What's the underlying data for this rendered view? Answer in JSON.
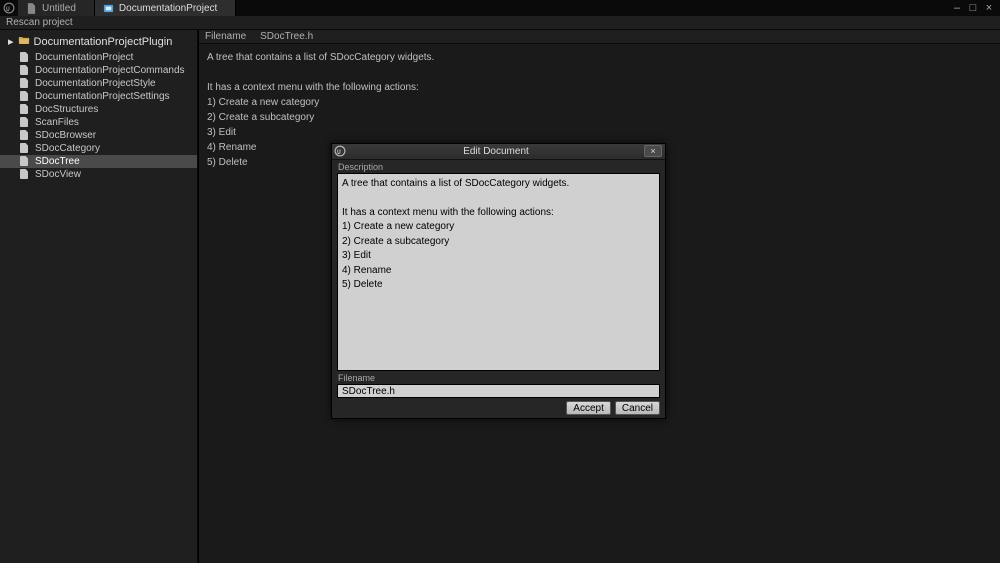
{
  "tabs": [
    {
      "label": "Untitled",
      "active": false
    },
    {
      "label": "DocumentationProject",
      "active": true
    }
  ],
  "rescan_label": "Rescan project",
  "sidebar": {
    "root_label": "DocumentationProjectPlugin",
    "items": [
      "DocumentationProject",
      "DocumentationProjectCommands",
      "DocumentationProjectStyle",
      "DocumentationProjectSettings",
      "DocStructures",
      "ScanFiles",
      "SDocBrowser",
      "SDocCategory",
      "SDocTree",
      "SDocView"
    ],
    "selected_index": 8
  },
  "content": {
    "header_label": "Filename",
    "header_value": "SDocTree.h",
    "body": "A tree that contains a list of SDocCategory widgets.\n\nIt has a context menu with the following actions:\n1) Create a new category\n2) Create a subcategory\n3) Edit\n4) Rename\n5) Delete"
  },
  "dialog": {
    "title": "Edit Document",
    "description_label": "Description",
    "description_value": "A tree that contains a list of SDocCategory widgets.\n\nIt has a context menu with the following actions:\n1) Create a new category\n2) Create a subcategory\n3) Edit\n4) Rename\n5) Delete",
    "filename_label": "Filename",
    "filename_value": "SDocTree.h",
    "accept_label": "Accept",
    "cancel_label": "Cancel"
  }
}
